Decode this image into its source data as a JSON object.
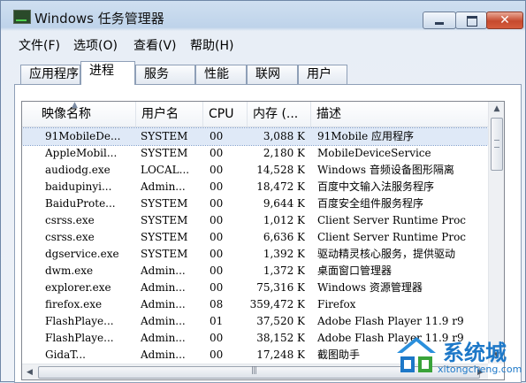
{
  "window": {
    "title": "Windows 任务管理器",
    "buttons": {
      "close": "✕"
    }
  },
  "menubar": [
    "文件(F)",
    "选项(O)",
    "查看(V)",
    "帮助(H)"
  ],
  "tabs": [
    "应用程序",
    "进程",
    "服务",
    "性能",
    "联网",
    "用户"
  ],
  "active_tab": "进程",
  "columns": [
    "映像名称",
    "用户名",
    "CPU",
    "内存 (...",
    "描述"
  ],
  "processes": [
    {
      "name": "91MobileDe...",
      "user": "SYSTEM",
      "cpu": "00",
      "mem": "3,088 K",
      "desc": "91Mobile 应用程序",
      "selected": true
    },
    {
      "name": "AppleMobil...",
      "user": "SYSTEM",
      "cpu": "00",
      "mem": "2,180 K",
      "desc": "MobileDeviceService"
    },
    {
      "name": "audiodg.exe",
      "user": "LOCAL...",
      "cpu": "00",
      "mem": "14,528 K",
      "desc": "Windows 音频设备图形隔离"
    },
    {
      "name": "baidupinyi...",
      "user": "Admin...",
      "cpu": "00",
      "mem": "18,472 K",
      "desc": "百度中文输入法服务程序"
    },
    {
      "name": "BaiduProte...",
      "user": "SYSTEM",
      "cpu": "00",
      "mem": "9,644 K",
      "desc": "百度安全组件服务程序"
    },
    {
      "name": "csrss.exe",
      "user": "SYSTEM",
      "cpu": "00",
      "mem": "1,012 K",
      "desc": "Client Server Runtime Proc"
    },
    {
      "name": "csrss.exe",
      "user": "SYSTEM",
      "cpu": "00",
      "mem": "6,636 K",
      "desc": "Client Server Runtime Proc"
    },
    {
      "name": "dgservice.exe",
      "user": "SYSTEM",
      "cpu": "00",
      "mem": "1,392 K",
      "desc": "驱动精灵核心服务，提供驱动"
    },
    {
      "name": "dwm.exe",
      "user": "Admin...",
      "cpu": "00",
      "mem": "1,372 K",
      "desc": "桌面窗口管理器"
    },
    {
      "name": "explorer.exe",
      "user": "Admin...",
      "cpu": "00",
      "mem": "75,316 K",
      "desc": "Windows 资源管理器"
    },
    {
      "name": "firefox.exe",
      "user": "Admin...",
      "cpu": "08",
      "mem": "359,472 K",
      "desc": "Firefox"
    },
    {
      "name": "FlashPlaye...",
      "user": "Admin...",
      "cpu": "01",
      "mem": "37,520 K",
      "desc": "Adobe Flash Player 11.9 r9"
    },
    {
      "name": "FlashPlaye...",
      "user": "Admin...",
      "cpu": "00",
      "mem": "38,152 K",
      "desc": "Adobe Flash Player 11.9 r9"
    },
    {
      "name": "GidaT...",
      "user": "Admin...",
      "cpu": "00",
      "mem": "17,248 K",
      "desc": "截图助手"
    }
  ],
  "watermark": {
    "brand": "系统城",
    "site": "xitongcheng.com"
  }
}
